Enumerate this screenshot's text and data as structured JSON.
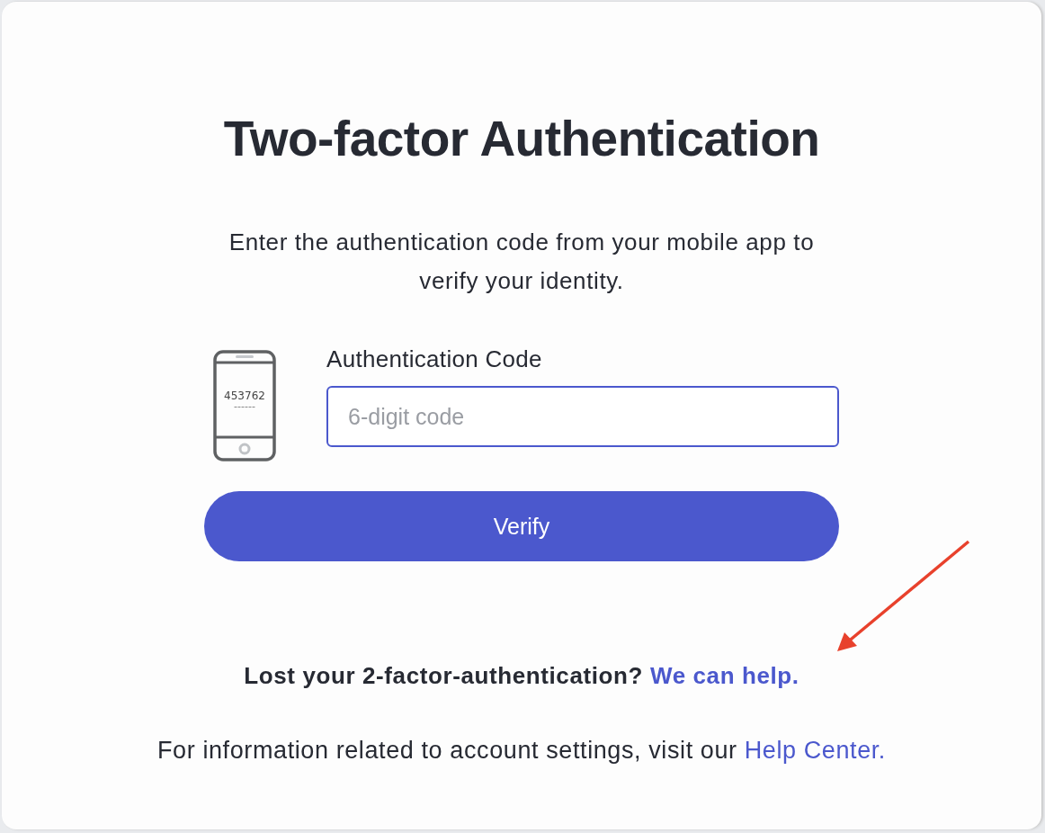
{
  "title": "Two-factor Authentication",
  "instructions": "Enter the authentication code from your mobile app to verify your identity.",
  "phone": {
    "code": "453762",
    "blank": "------"
  },
  "code_field": {
    "label": "Authentication Code",
    "placeholder": "6-digit code",
    "focused": true
  },
  "verify_button": "Verify",
  "lost_prompt": {
    "text": "Lost your 2-factor-authentication?",
    "link": "We can help."
  },
  "info": {
    "text": "For information related to account settings, visit our",
    "link": "Help Center."
  }
}
